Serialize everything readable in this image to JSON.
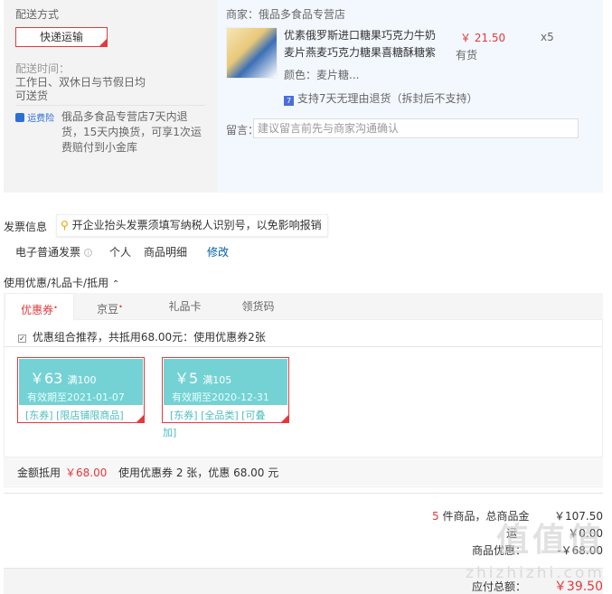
{
  "shipping": {
    "section_label": "配送方式",
    "method_button": "快递运输",
    "time_label": "配送时间：",
    "time_value_line1": "工作日、双休日与节假日均",
    "time_value_line2": "可送货",
    "insurance_badge": "运费险",
    "return_text_line1": "俄品多食品专营店7天内退",
    "return_text_line2": "货，15天内换货，可享1次运",
    "return_text_line3": "费赔付到小金库"
  },
  "store": {
    "label": "商家：俄品多食品专营店",
    "product": {
      "title_line1": "优素俄罗斯进口糖果巧克力牛奶",
      "title_line2": "麦片燕麦巧克力糖果喜糖酥糖紫",
      "price": "￥ 21.50",
      "quantity": "x5",
      "stock": "有货",
      "color": "颜色：麦片糖...",
      "return_policy": "支持7天无理由退货（拆封后不支持）"
    },
    "note_label": "留言：",
    "note_placeholder": "建议留言前先与商家沟通确认"
  },
  "invoice": {
    "section_label": "发票信息",
    "tip": "开企业抬头发票须填写纳税人识别号，以免影响报销",
    "type": "电子普通发票",
    "title": "个人",
    "content": "商品明细",
    "modify": "修改"
  },
  "coupons": {
    "section_label": "使用优惠/礼品卡/抵用",
    "tabs": [
      {
        "label": "优惠券",
        "star": "•"
      },
      {
        "label": "京豆",
        "star": "•"
      },
      {
        "label": "礼品卡",
        "star": ""
      },
      {
        "label": "领货码",
        "star": ""
      }
    ],
    "recommend_text": "优惠组合推荐，共抵用68.00元：使用优惠券2张",
    "items": [
      {
        "amount": "￥63",
        "condition": "满100",
        "expiry": "有效期至2021-01-07",
        "tags": "[东券] [限店铺限商品]",
        "tags_extra": ""
      },
      {
        "amount": "￥5",
        "condition": "满105",
        "expiry": "有效期至2020-12-31",
        "tags": "[东券] [全品类] [可叠",
        "tags_extra": "加]"
      }
    ],
    "deduct_label": "金额抵用",
    "deduct_amount": "￥68.00",
    "deduct_summary": "使用优惠券 2 张，优惠 68.00 元"
  },
  "summary": {
    "count_num": "5",
    "count_text": "件商品，总商品金",
    "total_goods": "￥107.50",
    "freight_label": "运",
    "freight": "￥0.00",
    "discount_label": "商品优惠：",
    "discount": "-￥68.00",
    "payable_label": "应付总额：",
    "payable": "￥39.50"
  },
  "watermark": {
    "main": "值值值",
    "sub": "zhizhizhi.com"
  }
}
